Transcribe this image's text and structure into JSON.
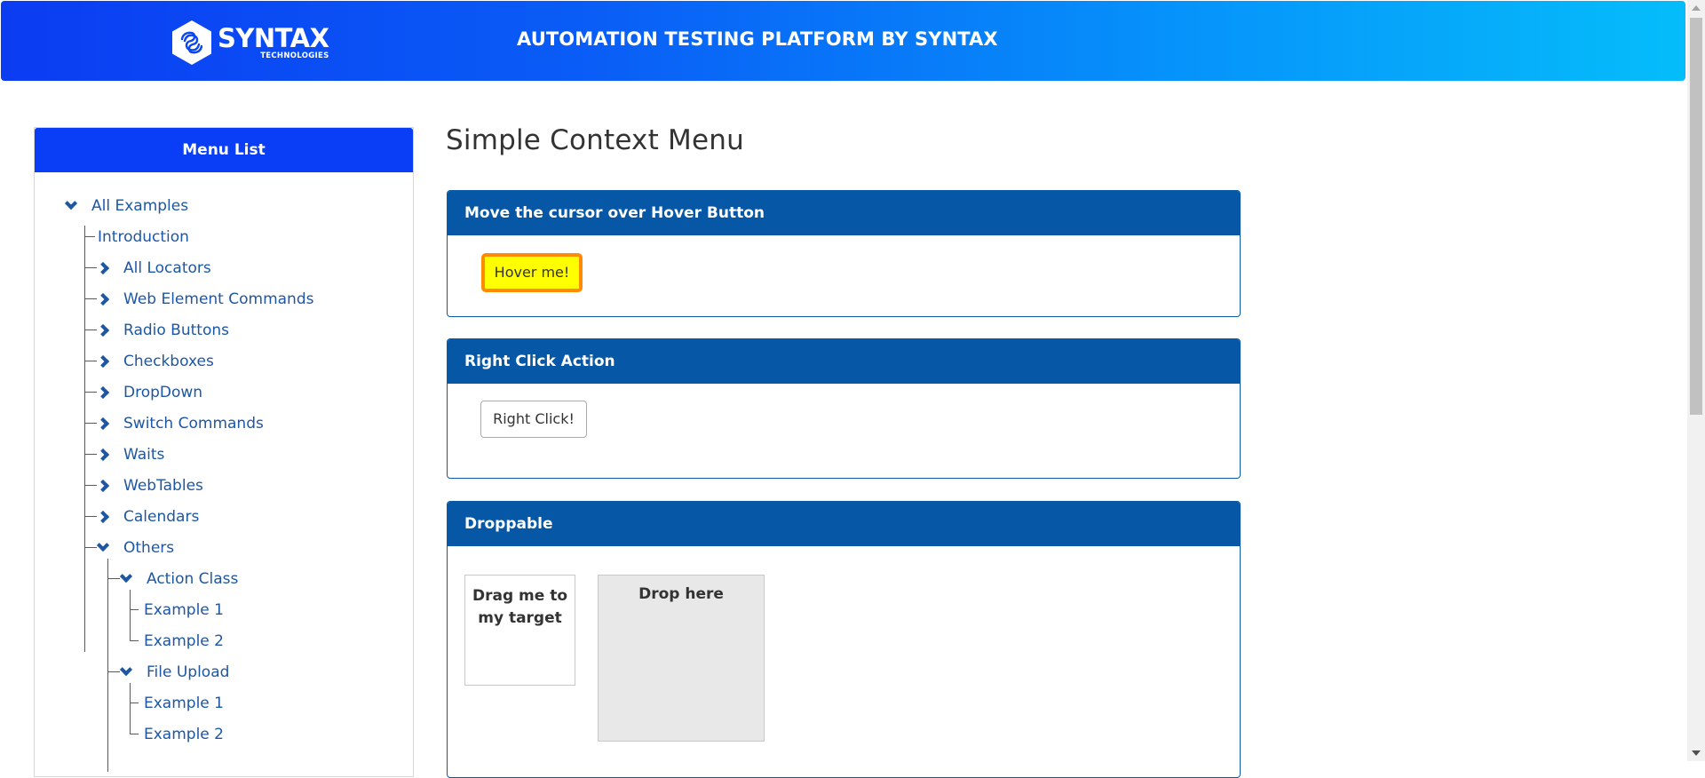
{
  "header": {
    "logo_main": "SYNTAX",
    "logo_sub": "TECHNOLOGIES",
    "title": "AUTOMATION TESTING PLATFORM BY SYNTAX"
  },
  "sidebar": {
    "title": "Menu List",
    "items": [
      {
        "label": "All Examples",
        "icon": "chevron-down-icon"
      },
      {
        "label": "Introduction"
      },
      {
        "label": "All Locators",
        "icon": "chevron-right-icon"
      },
      {
        "label": "Web Element Commands",
        "icon": "chevron-right-icon"
      },
      {
        "label": "Radio Buttons",
        "icon": "chevron-right-icon"
      },
      {
        "label": "Checkboxes",
        "icon": "chevron-right-icon"
      },
      {
        "label": "DropDown",
        "icon": "chevron-right-icon"
      },
      {
        "label": "Switch Commands",
        "icon": "chevron-right-icon"
      },
      {
        "label": "Waits",
        "icon": "chevron-right-icon"
      },
      {
        "label": "WebTables",
        "icon": "chevron-right-icon"
      },
      {
        "label": "Calendars",
        "icon": "chevron-right-icon"
      },
      {
        "label": "Others",
        "icon": "chevron-down-icon"
      },
      {
        "label": "Action Class",
        "icon": "chevron-down-icon"
      },
      {
        "label": "Example 1"
      },
      {
        "label": "Example 2"
      },
      {
        "label": "File Upload",
        "icon": "chevron-down-icon"
      },
      {
        "label": "Example 1"
      },
      {
        "label": "Example 2"
      }
    ]
  },
  "main": {
    "page_title": "Simple Context Menu",
    "hover_panel": {
      "title": "Move the cursor over Hover Button",
      "button_label": "Hover me!"
    },
    "right_click_panel": {
      "title": "Right Click Action",
      "button_label": "Right Click!"
    },
    "droppable_panel": {
      "title": "Droppable",
      "drag_label": "Drag me to my target",
      "drop_label": "Drop here"
    }
  },
  "colors": {
    "header_gradient_start": "#0b3cf2",
    "header_gradient_end": "#05bdfa",
    "menu_header": "#0a3ef6",
    "panel_header": "#0757a7",
    "tree_link": "#1d57a3",
    "hover_button_bg": "#ffff00",
    "hover_button_border": "#ff8c00",
    "drop_area": "#e8e8e8"
  }
}
